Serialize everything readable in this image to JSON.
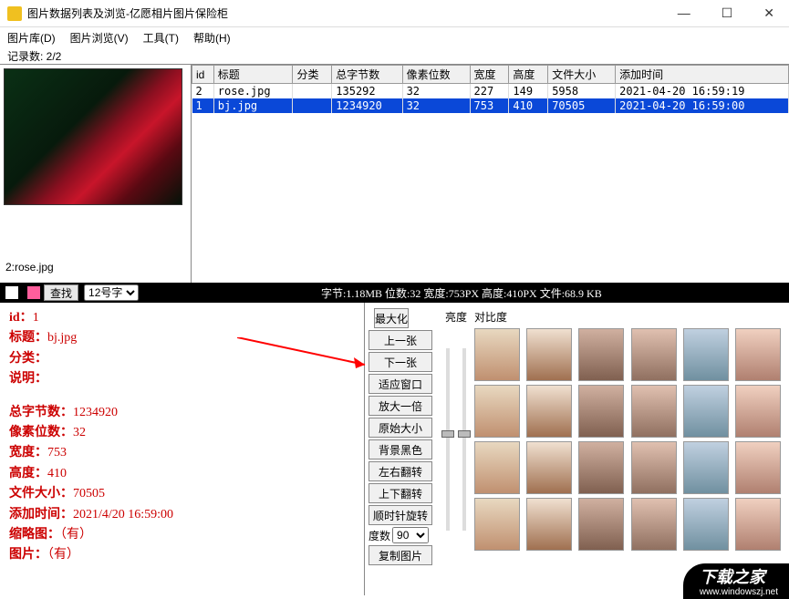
{
  "title": "图片数据列表及浏览-亿愿相片图片保险柜",
  "menu": {
    "m1": "图片库(D)",
    "m2": "图片浏览(V)",
    "m3": "工具(T)",
    "m4": "帮助(H)"
  },
  "record_count_label": "记录数: 2/2",
  "table": {
    "headers": [
      "id",
      "标题",
      "分类",
      "总字节数",
      "像素位数",
      "宽度",
      "高度",
      "文件大小",
      "添加时间"
    ],
    "rows": [
      {
        "cells": [
          "2",
          "rose.jpg",
          "",
          "135292",
          "32",
          "227",
          "149",
          "5958",
          "2021-04-20 16:59:19"
        ],
        "selected": false
      },
      {
        "cells": [
          "1",
          "bj.jpg",
          "",
          "1234920",
          "32",
          "753",
          "410",
          "70505",
          "2021-04-20 16:59:00"
        ],
        "selected": true
      }
    ]
  },
  "preview_caption": "2:rose.jpg",
  "search": {
    "find": "查找",
    "font_size": "12号字"
  },
  "status_bar": "字节:1.18MB 位数:32 宽度:753PX 高度:410PX 文件:68.9 KB",
  "detail": {
    "id_label": "id：",
    "id_val": "1",
    "title_label": "标题：",
    "title_val": "bj.jpg",
    "cat_label": "分类：",
    "cat_val": "",
    "desc_label": "说明：",
    "desc_val": "",
    "bytes_label": "总字节数：",
    "bytes_val": "1234920",
    "bits_label": "像素位数：",
    "bits_val": "32",
    "width_label": "宽度：",
    "width_val": "753",
    "height_label": "高度：",
    "height_val": "410",
    "fsize_label": "文件大小：",
    "fsize_val": "70505",
    "time_label": "添加时间：",
    "time_val": "2021/4/20 16:59:00",
    "thumb_label": "缩略图：",
    "thumb_val": "（有）",
    "pic_label": "图片：",
    "pic_val": "（有）"
  },
  "buttons": {
    "maximize": "最大化",
    "brightness": "亮度",
    "contrast": "对比度",
    "prev": "上一张",
    "next": "下一张",
    "fit": "适应窗口",
    "zoom2x": "放大一倍",
    "orig": "原始大小",
    "blackbg": "背景黑色",
    "fliph": "左右翻转",
    "flipv": "上下翻转",
    "rotcw": "顺时针旋转",
    "degree_label": "度数",
    "degree_val": "90",
    "copy": "复制图片"
  },
  "watermark": {
    "name": "下载之家",
    "url": "www.windowszj.net"
  }
}
